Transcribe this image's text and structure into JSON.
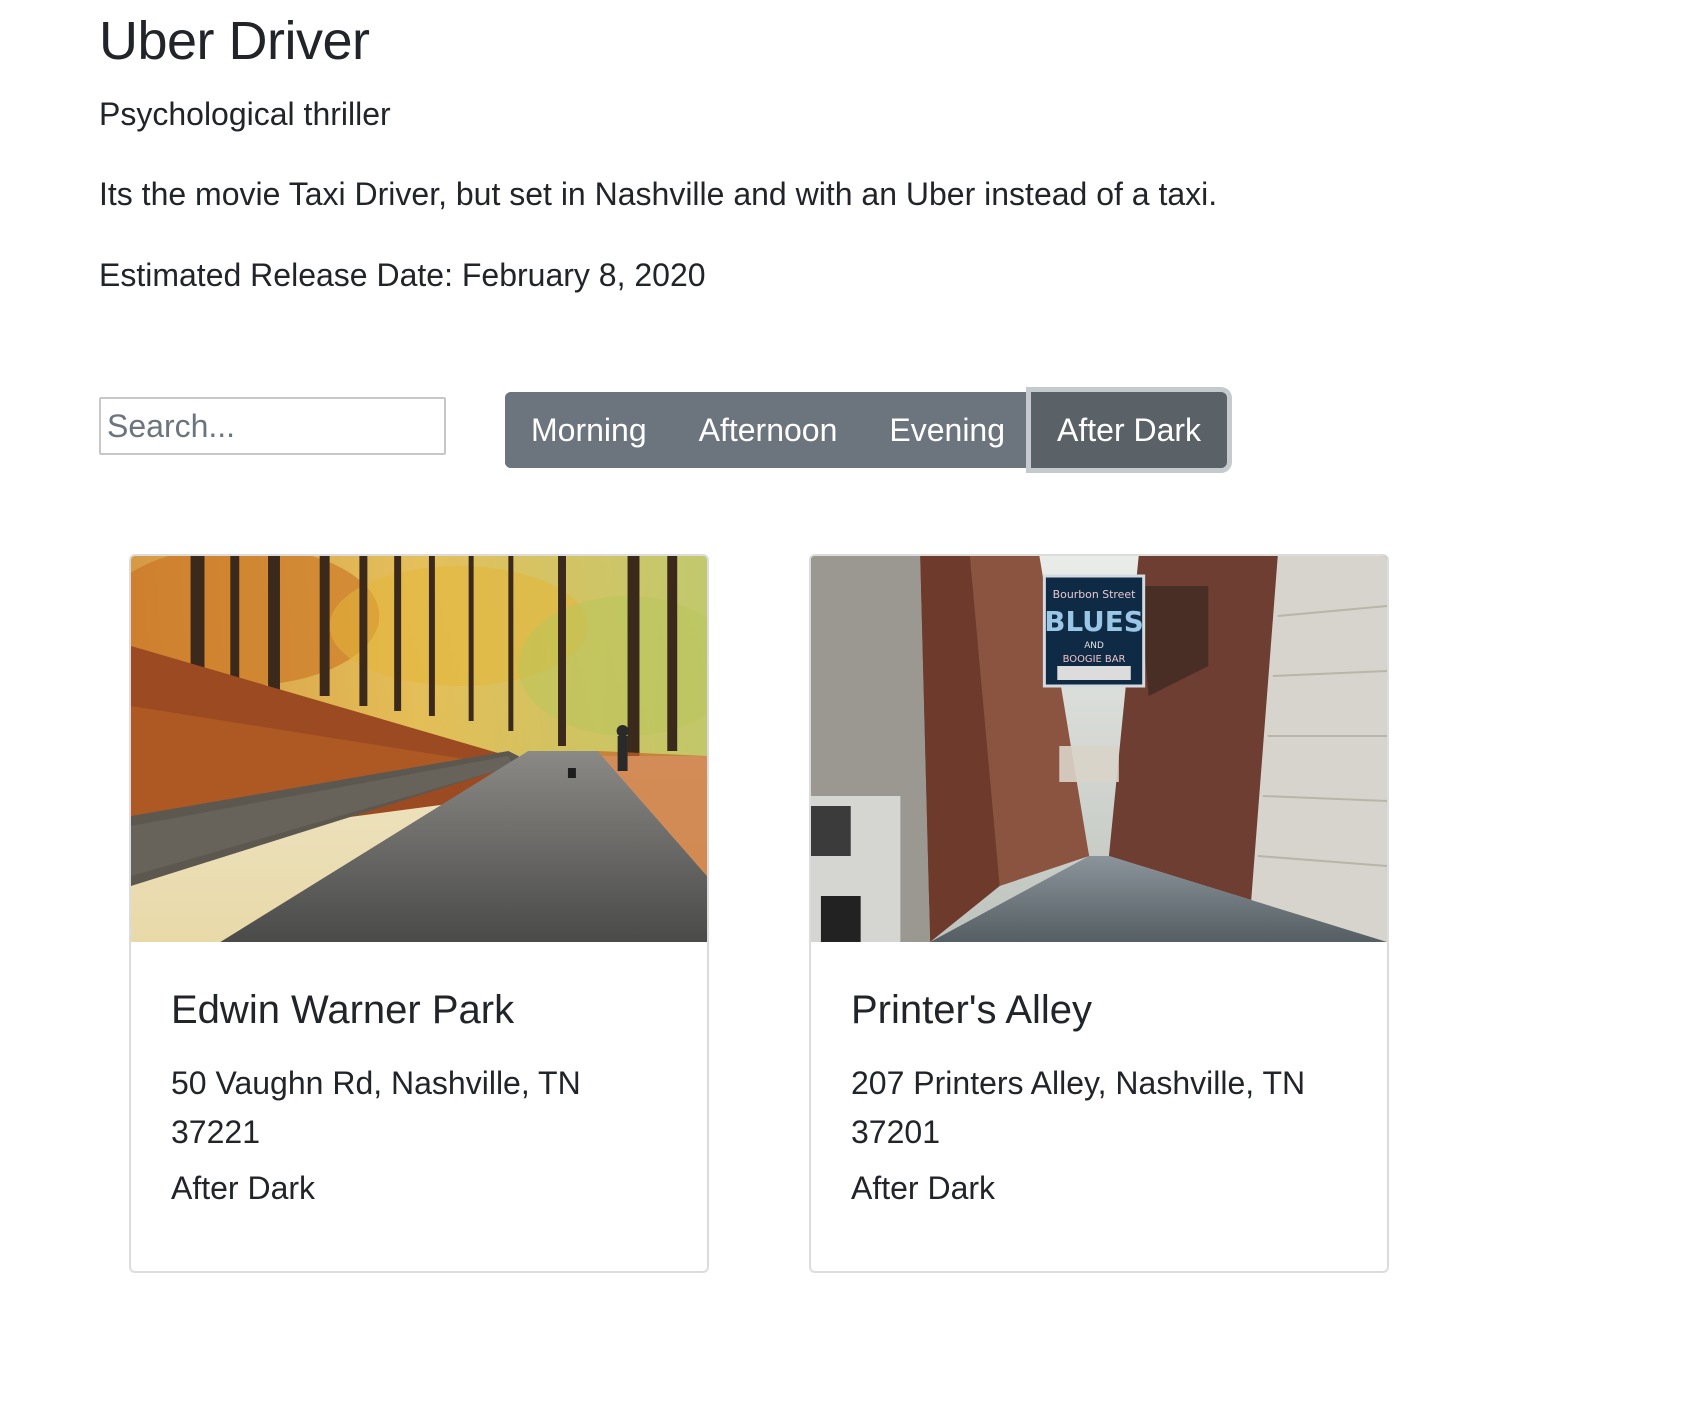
{
  "movie": {
    "title": "Uber Driver",
    "genre": "Psychological thriller",
    "description": "Its the movie Taxi Driver, but set in Nashville and with an Uber instead of a taxi.",
    "release": "Estimated Release Date: February 8, 2020"
  },
  "search": {
    "placeholder": "Search...",
    "value": ""
  },
  "filters": {
    "options": [
      "Morning",
      "Afternoon",
      "Evening",
      "After Dark"
    ],
    "selected": "After Dark"
  },
  "locations": [
    {
      "name": "Edwin Warner Park",
      "address": "50 Vaughn Rd, Nashville, TN 37221",
      "time": "After Dark",
      "image_icon": "autumn-park-path-photo"
    },
    {
      "name": "Printer's Alley",
      "address": "207 Printers Alley, Nashville, TN 37201",
      "time": "After Dark",
      "image_icon": "city-alley-photo",
      "sign_text": [
        "Bourbon Street",
        "BLUES",
        "AND",
        "BOOGIE BAR"
      ]
    }
  ],
  "colors": {
    "button_bg": "#6c757d",
    "button_active_bg": "#5a6268",
    "text": "#212529"
  }
}
